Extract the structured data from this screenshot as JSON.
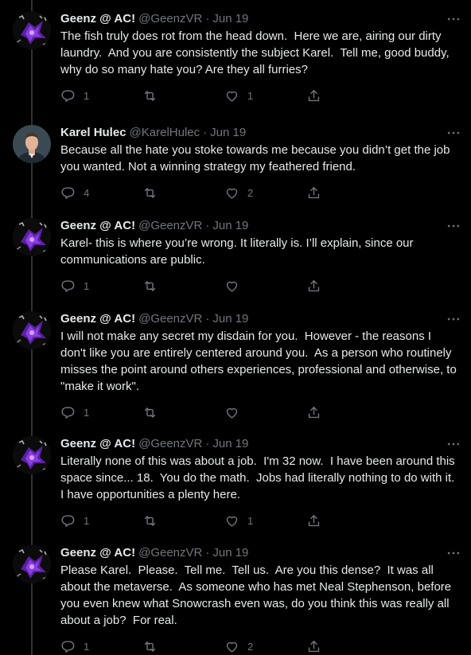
{
  "tweets": [
    {
      "name": "Geenz @ AC!",
      "handle": "@GeenzVR",
      "date": "Jun 19",
      "text": "The fish truly does rot from the head down.  Here we are, airing our dirty laundry.  And you are consistently the subject Karel.  Tell me, good buddy, why do so many hate you? Are they all furries?",
      "replies": "1",
      "retweets": "",
      "likes": "1",
      "avatar": "purple-creature-avatar"
    },
    {
      "name": "Karel Hulec",
      "handle": "@KarelHulec",
      "date": "Jun 19",
      "text": "Because all the hate you stoke towards me because you didn’t get the job you wanted. Not a winning strategy my feathered friend.",
      "replies": "4",
      "retweets": "",
      "likes": "2",
      "avatar": "person-avatar"
    },
    {
      "name": "Geenz @ AC!",
      "handle": "@GeenzVR",
      "date": "Jun 19",
      "text": "Karel- this is where you’re wrong. It literally is. I’ll explain, since our communications are public.",
      "replies": "1",
      "retweets": "",
      "likes": "",
      "avatar": "purple-creature-avatar"
    },
    {
      "name": "Geenz @ AC!",
      "handle": "@GeenzVR",
      "date": "Jun 19",
      "text": "I will not make any secret my disdain for you.  However - the reasons I don't like you are entirely centered around you.  As a person who routinely misses the point around others experiences, professional and otherwise, to \"make it work\".",
      "replies": "1",
      "retweets": "",
      "likes": "",
      "avatar": "purple-creature-avatar"
    },
    {
      "name": "Geenz @ AC!",
      "handle": "@GeenzVR",
      "date": "Jun 19",
      "text": "Literally none of this was about a job.  I'm 32 now.  I have been around this space since... 18.  You do the math.  Jobs had literally nothing to do with it.  I have opportunities a plenty here.",
      "replies": "1",
      "retweets": "",
      "likes": "1",
      "avatar": "purple-creature-avatar"
    },
    {
      "name": "Geenz @ AC!",
      "handle": "@GeenzVR",
      "date": "Jun 19",
      "text": "Please Karel.  Please.  Tell me.  Tell us.  Are you this dense?  It was all about the metaverse.  As someone who has met Neal Stephenson, before you even knew what Snowcrash even was, do you think this was really all about a job?  For real.",
      "replies": "1",
      "retweets": "",
      "likes": "2",
      "avatar": "purple-creature-avatar"
    }
  ],
  "colors": {
    "background": "#000000",
    "text": "#e7e9ea",
    "muted": "#71767b",
    "line": "#2f3336"
  }
}
